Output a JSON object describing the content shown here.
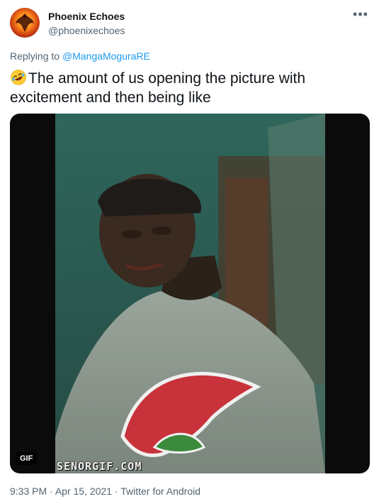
{
  "author": {
    "name": "Phoenix Echoes",
    "handle": "@phoenixechoes",
    "avatar_icon": "phoenix-avatar-icon"
  },
  "more_icon": "more-options-icon",
  "reply": {
    "prefix": "Replying to",
    "mention": "@MangaMoguraRE"
  },
  "tweet": {
    "emoji": "rolling-on-floor-laughing-emoji",
    "text": "The amount of us opening the picture with excitement and then being like"
  },
  "media": {
    "badge": "GIF",
    "watermark": "SENORGIF.COM"
  },
  "meta": {
    "time": "9:33 PM",
    "date": "Apr 15, 2021",
    "client": "Twitter for Android",
    "separator": "·"
  },
  "colors": {
    "link": "#1d9bf0",
    "secondary": "#536471",
    "primary": "#0f1419"
  }
}
